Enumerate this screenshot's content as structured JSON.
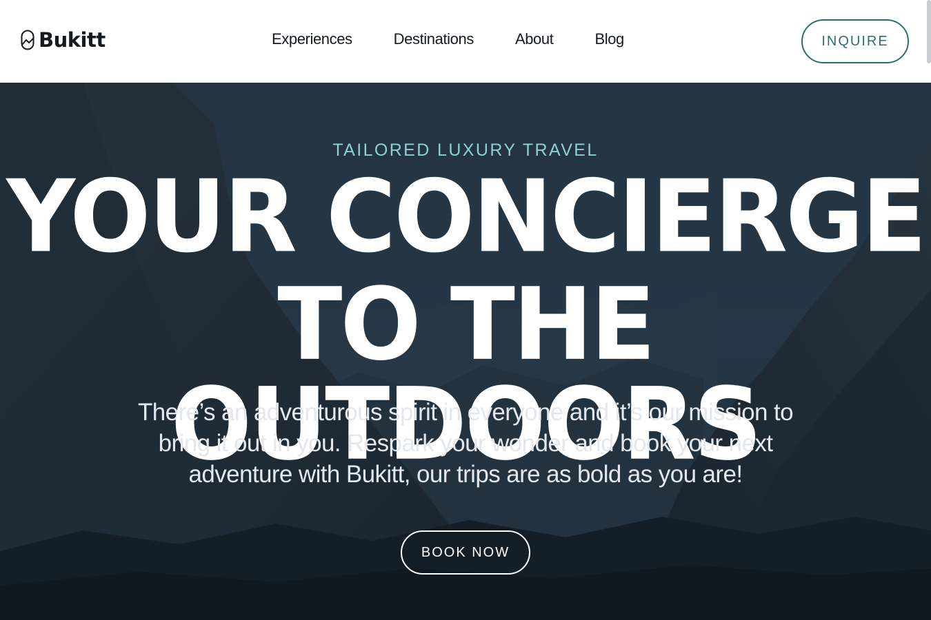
{
  "header": {
    "logo_text": "Bukitt",
    "logo_icon": "capsule-mountain-logo-icon",
    "nav": [
      {
        "label": "Experiences"
      },
      {
        "label": "Destinations"
      },
      {
        "label": "About"
      },
      {
        "label": "Blog"
      }
    ],
    "inquire_label": "INQUIRE"
  },
  "hero": {
    "eyebrow": "TAILORED LUXURY TRAVEL",
    "headline_line1": "YOUR CONCIERGE",
    "headline_line2": "TO THE OUTDOORS",
    "subtitle": "There’s an adventurous spirit in everyone and it’s our mission to bring it out in you. Respark your wonder and book your next adventure with Bukitt, our trips are as bold as you are!",
    "book_label": "BOOK NOW"
  },
  "colors": {
    "accent": "#2b6d74",
    "eyebrow": "#8fd0d2",
    "text_dark": "#151a1e",
    "hero_overlay": "#1f2e3b"
  }
}
